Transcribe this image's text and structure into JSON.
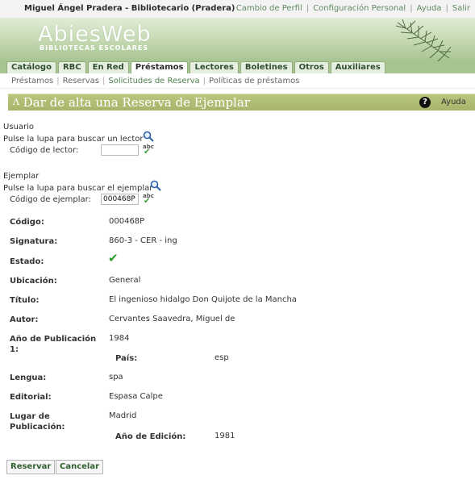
{
  "header": {
    "user": "Miguel Ángel Pradera - Bibliotecario (Pradera)",
    "links": [
      "Cambio de Perfil",
      "Configuración Personal",
      "Ayuda",
      "Salir"
    ]
  },
  "logo": {
    "main": "AbiesWeb",
    "sub": "BIBLIOTECAS ESCOLARES"
  },
  "tabs": [
    "Catálogo",
    "RBC",
    "En Red",
    "Préstamos",
    "Lectores",
    "Boletines",
    "Otros",
    "Auxiliares"
  ],
  "active_tab": "Préstamos",
  "subnav": [
    "Préstamos",
    "Reservas",
    "Solicitudes de Reserva",
    "Políticas de préstamos"
  ],
  "active_subnav": "Solicitudes de Reserva",
  "page": {
    "title": "Dar de alta una Reserva de Ejemplar",
    "help": "Ayuda"
  },
  "usuario": {
    "section": "Usuario",
    "hint": "Pulse la lupa para buscar un lector",
    "label": "Código de lector:",
    "value": ""
  },
  "ejemplar": {
    "section": "Ejemplar",
    "hint": "Pulse la lupa para buscar el ejemplar",
    "label": "Código de ejemplar:",
    "value": "000468P"
  },
  "spell_icon_text": "abc",
  "details": {
    "codigo": {
      "label": "Código:",
      "value": "000468P"
    },
    "signatura": {
      "label": "Signatura:",
      "value": "860-3 - CER - ing"
    },
    "estado": {
      "label": "Estado:"
    },
    "ubicacion": {
      "label": "Ubicación:",
      "value": "General"
    },
    "titulo": {
      "label": "Título:",
      "value": "El ingenioso hidalgo Don Quijote de la Mancha"
    },
    "autor": {
      "label": "Autor:",
      "value": "Cervantes Saavedra, Miguel de"
    },
    "anio_pub": {
      "label": "Año de Publicación 1:",
      "value": "1984"
    },
    "pais": {
      "label": "País:",
      "value": "esp"
    },
    "lengua": {
      "label": "Lengua:",
      "value": "spa"
    },
    "editorial": {
      "label": "Editorial:",
      "value": "Espasa Calpe"
    },
    "lugar": {
      "label": "Lugar de Publicación:",
      "value": "Madrid"
    },
    "anio_ed": {
      "label": "Año de Edición:",
      "value": "1981"
    }
  },
  "buttons": {
    "reservar": "Reservar",
    "cancelar": "Cancelar"
  },
  "colors": {
    "accent": "#a6b56a",
    "brand": "#a7c491",
    "link": "#5f8a5f",
    "ok": "#2e9b2e"
  }
}
